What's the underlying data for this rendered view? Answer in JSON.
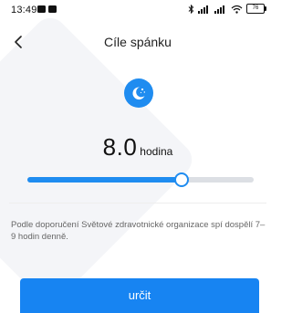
{
  "status_bar": {
    "time": "13:49",
    "battery": "76"
  },
  "header": {
    "title": "Cíle spánku",
    "back_icon": "chevron-left-icon"
  },
  "goal": {
    "icon": "moon-stars-icon",
    "value": "8.0",
    "unit": "hodina"
  },
  "slider": {
    "fraction": 0.68
  },
  "note": {
    "text": "Podle doporučení Světové zdravotnické organizace spí dospělí 7–9 hodin denně."
  },
  "actions": {
    "confirm_label": "určit"
  },
  "colors": {
    "accent": "#1784f2",
    "track": "#dcdfe4"
  }
}
